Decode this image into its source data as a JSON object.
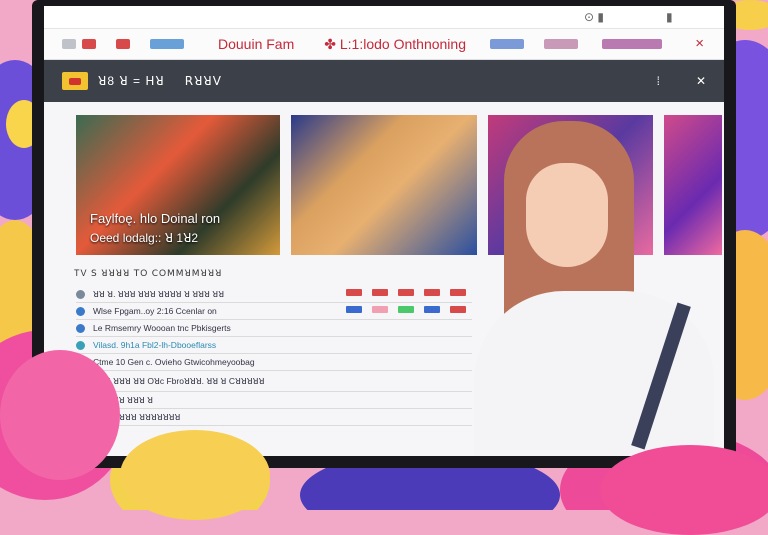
{
  "window": {
    "topbar_icons": [
      "eye-icon",
      "notification-icon"
    ]
  },
  "tabbar": {
    "title": "Douuin Fam",
    "subtitle": "✤ L:1:lodo Onthnoning",
    "close_icon": "×"
  },
  "header": {
    "nav_left": "ꓤ8 ꓤ = ꓧꓤ",
    "nav_right": "ꓣꓤꓤꓦ",
    "icon_right_1": "⁞",
    "icon_right_2": "✕"
  },
  "media": [
    {
      "caption_line1": "Faylfoę. hlo Doinal ron",
      "caption_line2": "Oeed lodalg:: ꓤ 1ꓤ2"
    },
    {
      "caption_line1": "",
      "caption_line2": ""
    },
    {
      "caption_line1": "",
      "caption_line2": ""
    },
    {
      "caption_line1": "",
      "caption_line2": ""
    }
  ],
  "list_section": {
    "title": "TV ꓢ ꓤꓤꓤꓤ  ꓔO ꓚOꓟꓟꓤꓟꓤꓤꓤ",
    "rows": [
      {
        "text": "ꓤꓤ ꓤ. ꓤꓤꓤ ꓤꓤꓤ ꓤꓤꓤꓤ ꓤ ꓤꓤꓤ ꓤꓤ",
        "icon_color": "#7a8a9a"
      },
      {
        "text": "Wlse Fpgam..oy 2:16 Ccenlar on",
        "icon_color": "#3a7ac8"
      },
      {
        "text": "Le Rmsemry Woooan tnc Pbkisgerts",
        "icon_color": "#3a7ac8"
      },
      {
        "text": "Vilasd. 9h1a Fbl2-lh-Dbooeflarss",
        "icon_color": "#3aa0b8"
      },
      {
        "text": "Ctme 10 Gen c. Ovieho Gtwicohmeyoobag",
        "icon_color": "#3a7ac8"
      },
      {
        "text": "ꓤꓤꓤ ꓤꓤꓤ  ꓤꓤ Oꓤc Fbroꓤꓤꓤ. ꓤꓤ ꓤ Cꓤꓤꓤꓤꓤ",
        "icon_color": "#7a8a9a"
      },
      {
        "text": "Vꓚ ꓤꓤꓤ ꓤꓤꓤ ꓤ",
        "icon_color": "#7a8a9a"
      },
      {
        "text": "ꓤꓤ ꓤꓤꓤꓤꓤ ꓤꓤꓤꓤꓤꓤꓤ",
        "icon_color": "#7a8a9a"
      }
    ]
  },
  "colors": {
    "accent": "#c42a3a",
    "header_bg": "#3c4048"
  }
}
